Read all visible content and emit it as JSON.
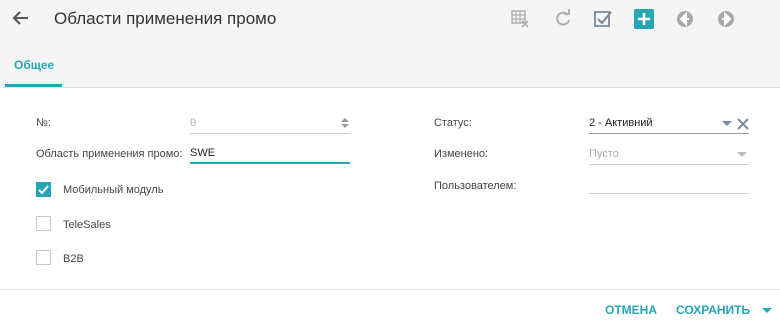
{
  "header": {
    "title": "Области применения промо",
    "icons": [
      "arrow-left-icon",
      "table-delete-icon",
      "refresh-icon",
      "checkbox-icon",
      "plus-icon",
      "circle-left-icon",
      "circle-right-icon"
    ]
  },
  "tabs": [
    {
      "label": "Общее",
      "active": true
    }
  ],
  "form": {
    "number": {
      "label": "№:",
      "value": "0"
    },
    "area": {
      "label": "Область применения промо:",
      "value": "SWE"
    },
    "status": {
      "label": "Статус:",
      "value": "2 - Активний"
    },
    "changed": {
      "label": "Изменено:",
      "value": "Пусто"
    },
    "user": {
      "label": "Пользователем:",
      "value": ""
    },
    "checkboxes": [
      {
        "label": "Мобильный модуль",
        "checked": true
      },
      {
        "label": "TeleSales",
        "checked": false
      },
      {
        "label": "B2B",
        "checked": false
      }
    ]
  },
  "footer": {
    "cancel": "ОТМЕНА",
    "save": "СОХРАНИТЬ"
  },
  "colors": {
    "accent": "#26a6b5",
    "icon_gray": "#a9a9a9"
  }
}
